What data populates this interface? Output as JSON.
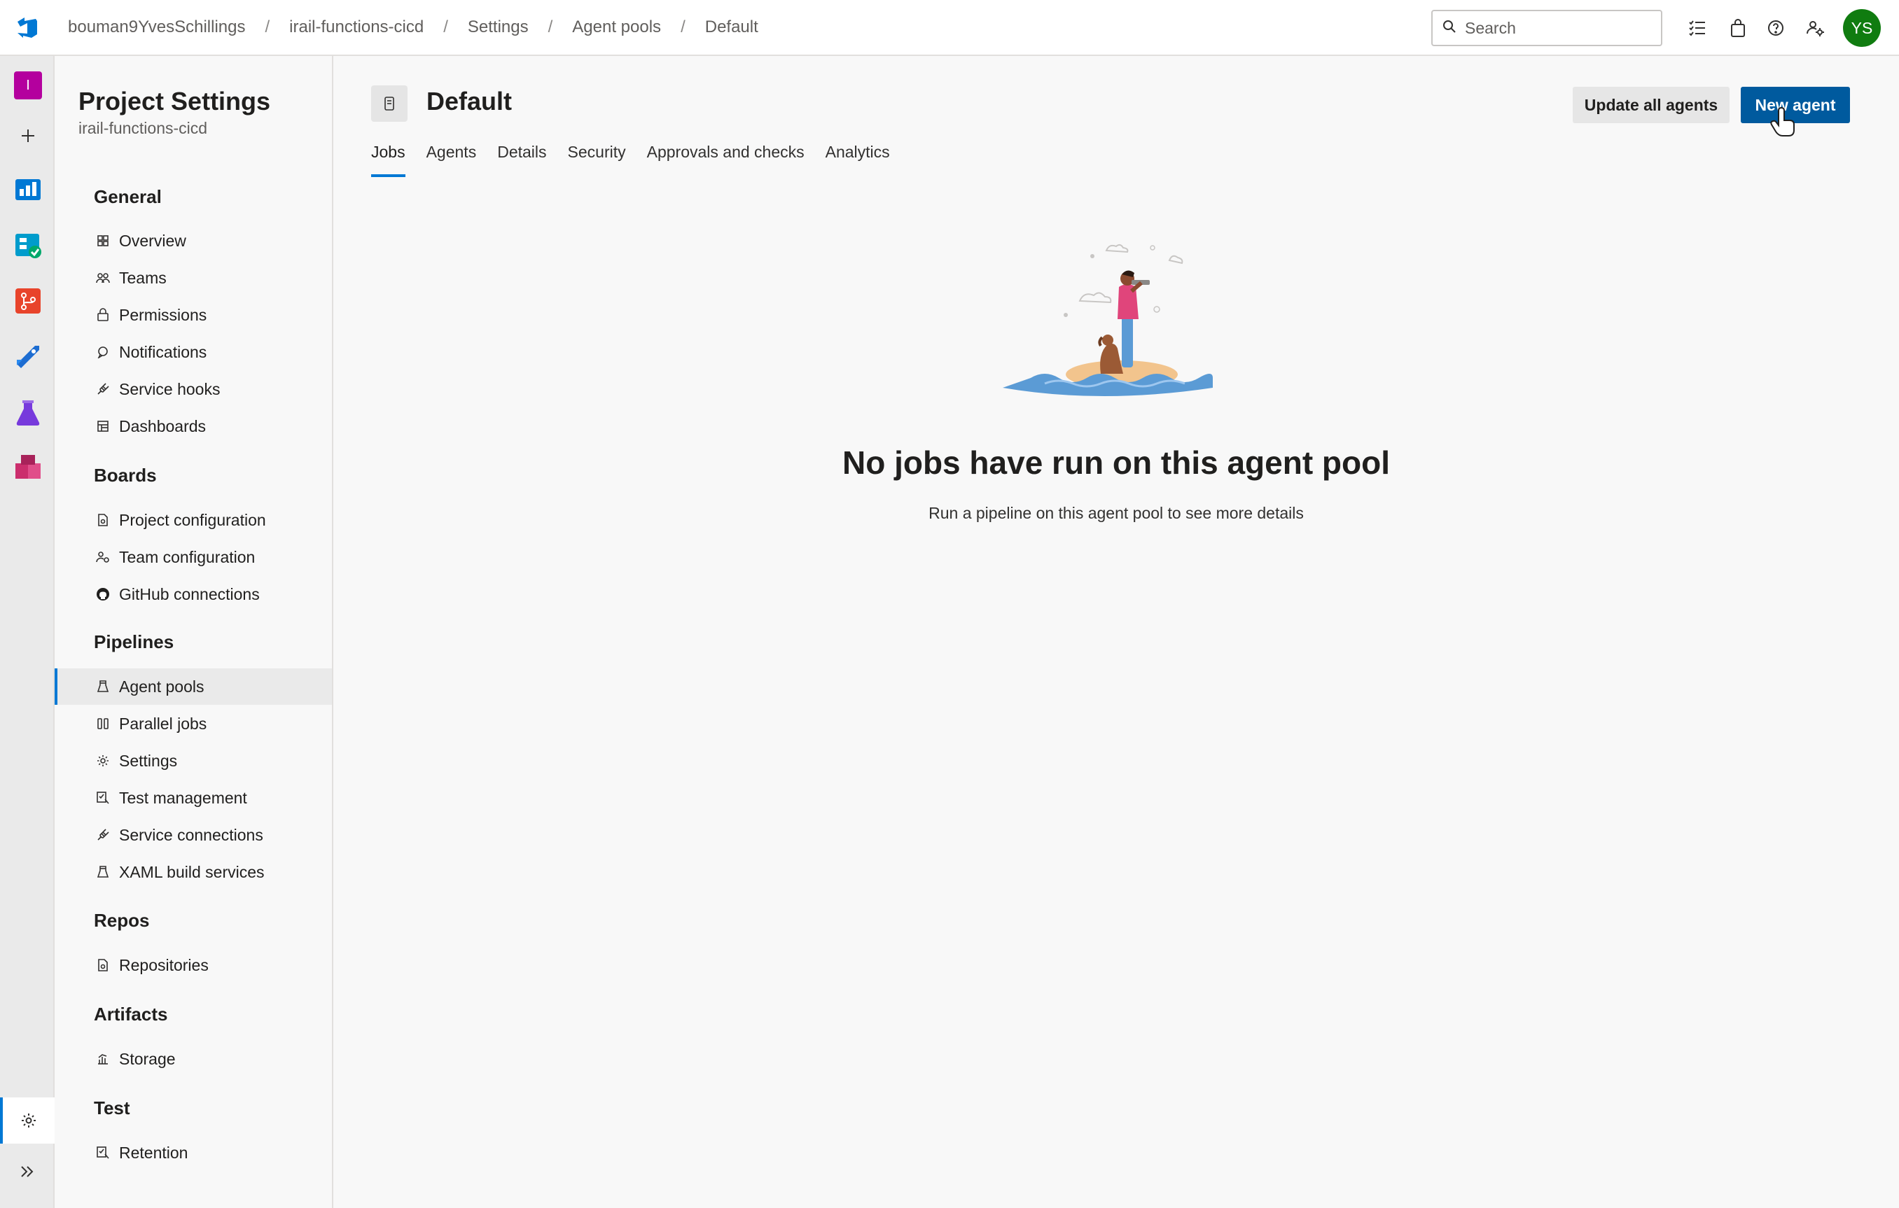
{
  "breadcrumb": [
    "bouman9YvesSchillings",
    "irail-functions-cicd",
    "Settings",
    "Agent pools",
    "Default"
  ],
  "search": {
    "placeholder": "Search"
  },
  "user": {
    "initials": "YS"
  },
  "sidenav": {
    "title": "Project Settings",
    "subtitle": "irail-functions-cicd",
    "sections": {
      "general": "General",
      "boards": "Boards",
      "pipelines": "Pipelines",
      "repos": "Repos",
      "artifacts": "Artifacts",
      "test": "Test"
    },
    "items": {
      "overview": "Overview",
      "teams": "Teams",
      "permissions": "Permissions",
      "notifications": "Notifications",
      "service_hooks": "Service hooks",
      "dashboards": "Dashboards",
      "project_configuration": "Project configuration",
      "team_configuration": "Team configuration",
      "github_connections": "GitHub connections",
      "agent_pools": "Agent pools",
      "parallel_jobs": "Parallel jobs",
      "settings": "Settings",
      "test_management": "Test management",
      "service_connections": "Service connections",
      "xaml_build_services": "XAML build services",
      "repositories": "Repositories",
      "storage": "Storage",
      "retention": "Retention"
    }
  },
  "page": {
    "title": "Default",
    "update_all_label": "Update all agents",
    "new_agent_label": "New agent",
    "tabs": [
      "Jobs",
      "Agents",
      "Details",
      "Security",
      "Approvals and checks",
      "Analytics"
    ],
    "empty_title": "No jobs have run on this agent pool",
    "empty_subtitle": "Run a pipeline on this agent pool to see more details"
  },
  "colors": {
    "accent": "#0078d4",
    "primary_button": "#005a9e",
    "avatar": "#107c10"
  }
}
